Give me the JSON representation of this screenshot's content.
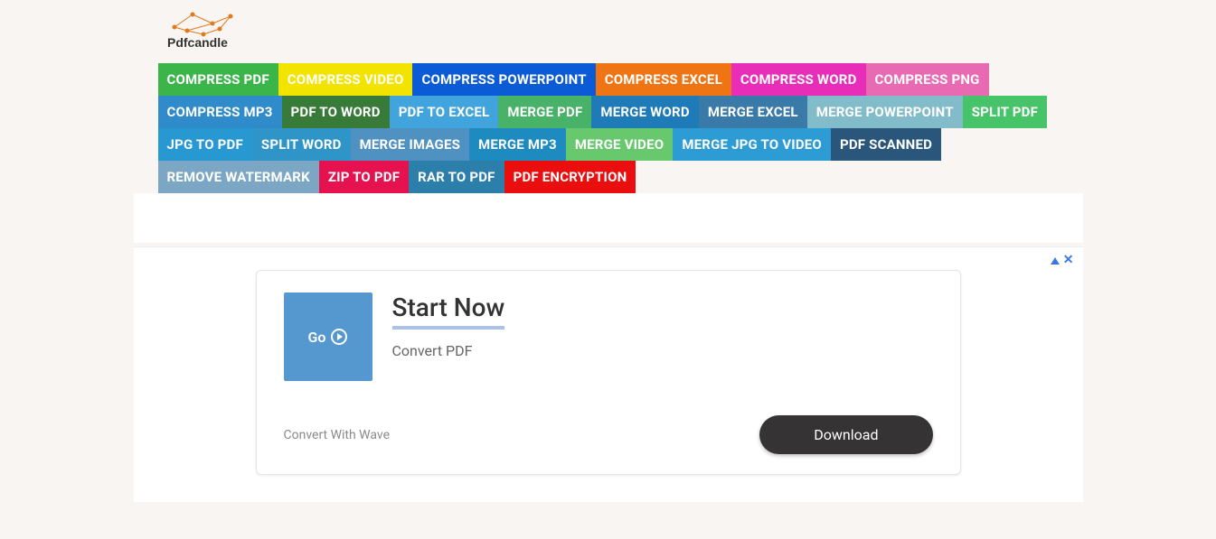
{
  "logo_text": "Pdfcandle",
  "nav": [
    {
      "label": "COMPRESS PDF",
      "color": "c-green"
    },
    {
      "label": "COMPRESS VIDEO",
      "color": "c-yellow"
    },
    {
      "label": "COMPRESS POWERPOINT",
      "color": "c-blue"
    },
    {
      "label": "COMPRESS EXCEL",
      "color": "c-orange"
    },
    {
      "label": "COMPRESS WORD",
      "color": "c-magenta"
    },
    {
      "label": "COMPRESS PNG",
      "color": "c-pinklav"
    },
    {
      "label": "COMPRESS MP3",
      "color": "c-blue3"
    },
    {
      "label": "PDF TO WORD",
      "color": "c-green-dark"
    },
    {
      "label": "PDF TO EXCEL",
      "color": "c-blue-med"
    },
    {
      "label": "MERGE PDF",
      "color": "c-green-mid"
    },
    {
      "label": "MERGE WORD",
      "color": "c-blue5"
    },
    {
      "label": "MERGE EXCEL",
      "color": "c-blue-grey"
    },
    {
      "label": "MERGE POWERPOINT",
      "color": "c-teal-light"
    },
    {
      "label": "SPLIT PDF",
      "color": "c-green2"
    },
    {
      "label": "JPG TO PDF",
      "color": "c-blue2"
    },
    {
      "label": "SPLIT WORD",
      "color": "c-blue4"
    },
    {
      "label": "MERGE IMAGES",
      "color": "c-blue-dim"
    },
    {
      "label": "MERGE MP3",
      "color": "c-blue6"
    },
    {
      "label": "MERGE VIDEO",
      "color": "c-green-l2"
    },
    {
      "label": "MERGE JPG TO VIDEO",
      "color": "c-blue7"
    },
    {
      "label": "PDF SCANNED",
      "color": "c-blue-dark"
    },
    {
      "label": "REMOVE WATERMARK",
      "color": "c-blue-pale"
    },
    {
      "label": "ZIP TO PDF",
      "color": "c-pinkred"
    },
    {
      "label": "RAR TO PDF",
      "color": "c-blue8"
    },
    {
      "label": "PDF ENCRYPTION",
      "color": "c-red"
    }
  ],
  "ad": {
    "go_label": "Go",
    "title": "Start Now",
    "subtitle": "Convert PDF",
    "attribution": "Convert With Wave",
    "download_label": "Download"
  }
}
